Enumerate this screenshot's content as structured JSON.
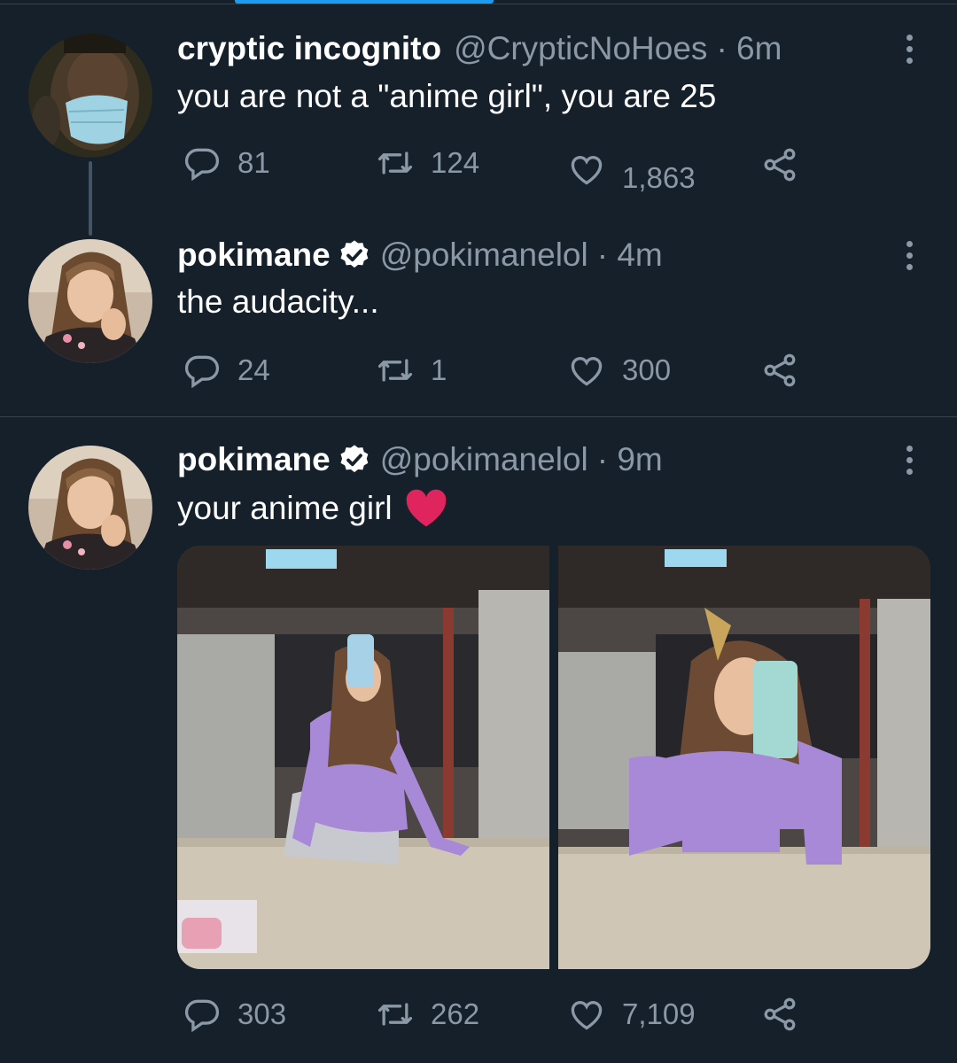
{
  "tweets": [
    {
      "author_name": "cryptic incognito",
      "handle": "@CrypticNoHoes",
      "time": "· 6m",
      "text": "you are not a \"anime girl\", you are 25",
      "replies": "81",
      "retweets": "124",
      "likes": "1,863",
      "verified": false
    },
    {
      "author_name": "pokimane",
      "handle": "@pokimanelol",
      "time": "· 4m",
      "text": "the audacity...",
      "replies": "24",
      "retweets": "1",
      "likes": "300",
      "verified": true
    },
    {
      "author_name": "pokimane",
      "handle": "@pokimanelol",
      "time": "· 9m",
      "text": "your anime girl",
      "emoji": "red-heart",
      "replies": "303",
      "retweets": "262",
      "likes": "7,109",
      "verified": true,
      "media_count": 2
    }
  ],
  "colors": {
    "background": "#15202b",
    "text": "#ffffff",
    "secondary": "#8b98a5",
    "divider": "#38444d",
    "accent": "#1d9bf0",
    "heart": "#e0245e"
  },
  "icons": {
    "reply": "reply-icon",
    "retweet": "retweet-icon",
    "like": "like-icon",
    "share": "share-icon",
    "more": "more-icon",
    "verified": "verified-badge-icon"
  }
}
